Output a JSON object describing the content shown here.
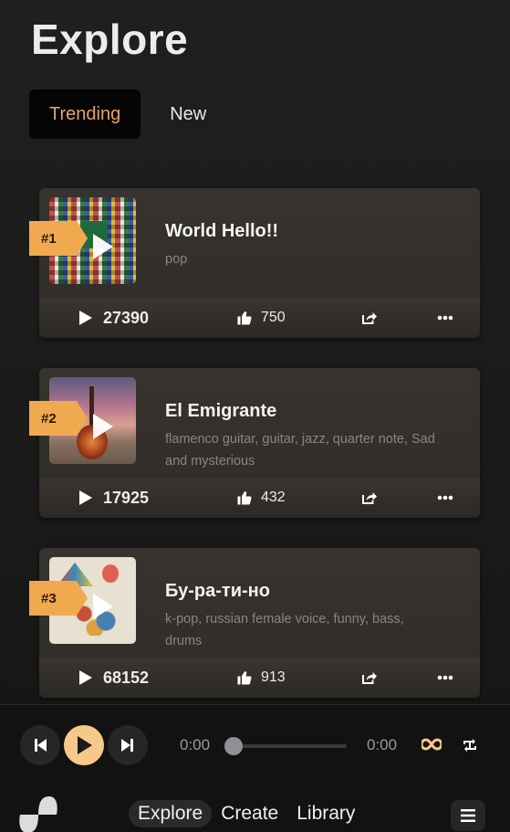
{
  "page": {
    "title": "Explore"
  },
  "tabs": [
    {
      "label": "Trending",
      "active": true
    },
    {
      "label": "New",
      "active": false
    }
  ],
  "songs": [
    {
      "rank": "#1",
      "title": "World Hello!!",
      "tags": "pop",
      "plays": "27390",
      "likes": "750",
      "cover": "flags-collage"
    },
    {
      "rank": "#2",
      "title": "El Emigrante",
      "tags": "flamenco guitar, guitar, jazz, quarter note,  Sad and mysterious",
      "plays": "17925",
      "likes": "432",
      "cover": "guitar-sunset"
    },
    {
      "rank": "#3",
      "title": "Бу-ра-ти-но",
      "tags": "k-pop, russian female voice, funny, bass, drums",
      "plays": "68152",
      "likes": "913",
      "cover": "carnival-illustration"
    }
  ],
  "player": {
    "current_time": "0:00",
    "total_time": "0:00",
    "progress": 0,
    "accent_color": "#f6c98b"
  },
  "nav": {
    "items": [
      {
        "label": "Explore",
        "active": true
      },
      {
        "label": "Create",
        "active": false
      },
      {
        "label": "Library",
        "active": false
      }
    ]
  },
  "colors": {
    "rank_badge": "#f1a950",
    "active_tab_text": "#e2a46a"
  }
}
